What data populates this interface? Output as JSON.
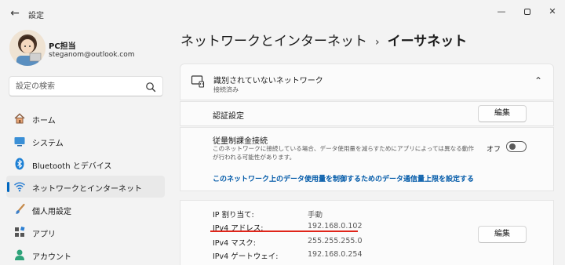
{
  "window": {
    "back": "←",
    "title": "設定",
    "minimize": "—",
    "close": "✕"
  },
  "profile": {
    "name": "PC担当",
    "email": "steganom@outlook.com"
  },
  "search": {
    "placeholder": "設定の検索"
  },
  "sidebar": {
    "items": [
      {
        "label": "ホーム",
        "icon": "home-icon"
      },
      {
        "label": "システム",
        "icon": "system-icon"
      },
      {
        "label": "Bluetooth とデバイス",
        "icon": "bluetooth-icon"
      },
      {
        "label": "ネットワークとインターネット",
        "icon": "network-icon",
        "active": true
      },
      {
        "label": "個人用設定",
        "icon": "brush-icon"
      },
      {
        "label": "アプリ",
        "icon": "apps-icon"
      },
      {
        "label": "アカウント",
        "icon": "account-icon"
      }
    ]
  },
  "breadcrumb": {
    "parent": "ネットワークとインターネット",
    "separator": "›",
    "current": "イーサネット"
  },
  "network": {
    "title": "識別されていないネットワーク",
    "status": "接続済み",
    "icon": "ethernet-icon"
  },
  "auth": {
    "label": "認証設定",
    "button": "編集"
  },
  "metered": {
    "title": "従量制課金接続",
    "description": "このネットワークに接続している場合、データ使用量を減らすためにアプリによっては異なる動作が行われる可能性があります。",
    "toggle_label": "オフ",
    "toggle_on": false,
    "link": "このネットワーク上のデータ使用量を制御するためのデータ通信量上限を設定する"
  },
  "ip": {
    "button": "編集",
    "rows": [
      {
        "key": "IP 割り当て:",
        "value": "手動"
      },
      {
        "key": "IPv4 アドレス:",
        "value": "192.168.0.102"
      },
      {
        "key": "IPv4 マスク:",
        "value": "255.255.255.0"
      },
      {
        "key": "IPv4 ゲートウェイ:",
        "value": "192.168.0.254"
      }
    ]
  },
  "colors": {
    "accent": "#0067c0",
    "link": "#0059a8",
    "highlight_underline": "#e0251a"
  }
}
